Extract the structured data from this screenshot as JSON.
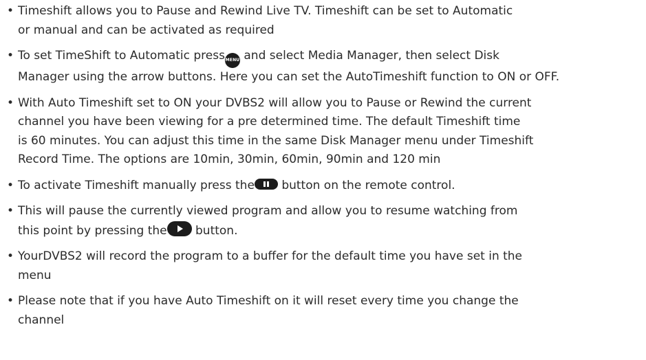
{
  "bullets": [
    {
      "lines": [
        "Timeshift allows you to Pause and Rewind Live TV. Timeshift can be set to Automatic",
        "or manual and can be activated as required"
      ]
    },
    {
      "line1_before_icon": "To set TimeShift to Automatic press",
      "menu_icon_text": "MENU",
      "line1_after_icon": " and select Media Manager, then select Disk",
      "line2": "Manager using the arrow buttons. Here you can set the AutoTimeshift function to ON or OFF."
    },
    {
      "lines": [
        "With Auto Timeshift set to ON your DVBS2 will allow you to Pause or Rewind the current",
        "channel you have been viewing for a pre determined time. The default Timeshift time",
        "is 60 minutes. You can adjust this time in the same Disk Manager menu under Timeshift",
        "Record Time. The options are 10min, 30min, 60min, 90min and 120 min"
      ]
    },
    {
      "before_icon": "To activate Timeshift manually press the",
      "after_icon": " button on the remote control."
    },
    {
      "line1": "This will pause the currently viewed program and allow you to resume watching from",
      "line2_before_icon": "this point by pressing the",
      "line2_after_icon": " button."
    },
    {
      "lines": [
        "YourDVBS2 will record the program to a buffer for the default time you have set in the",
        "menu"
      ]
    },
    {
      "lines": [
        "Please note that if you have Auto Timeshift on it will reset every time you change the",
        "channel"
      ]
    }
  ],
  "bullet_char": "•",
  "icons": {
    "menu": "menu-button-icon",
    "pause": "pause-button-icon",
    "play": "play-button-icon"
  },
  "colors": {
    "text": "#2b2b2b",
    "icon_fill": "#1c1c1c"
  }
}
